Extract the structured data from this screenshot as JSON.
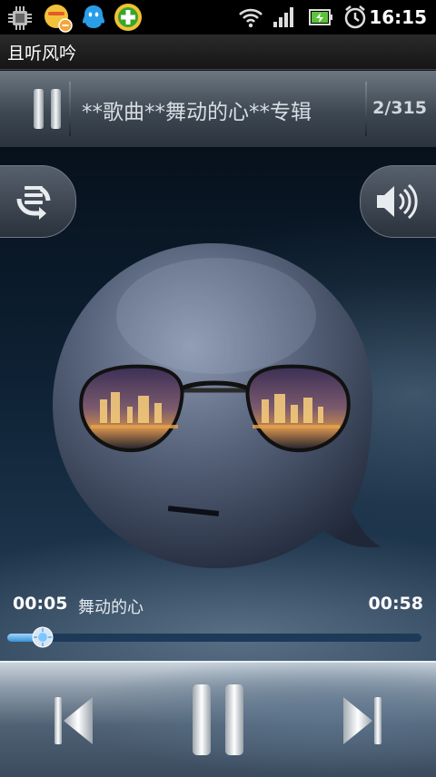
{
  "status_bar": {
    "time": "16:15",
    "icons": [
      "cpu-icon",
      "chat-notification-icon",
      "qq-icon",
      "security-plus-icon",
      "wifi-icon",
      "signal-icon",
      "battery-charging-icon",
      "alarm-clock-icon"
    ]
  },
  "app": {
    "title": "且听风吟"
  },
  "now_playing": {
    "title": "**歌曲**舞动的心**专辑",
    "track_count": "2/315"
  },
  "player": {
    "current_time": "00:05",
    "song_name": "舞动的心",
    "total_time": "00:58",
    "progress": 0.086
  },
  "colors": {
    "accent": "#4aa8ee",
    "title_bar": "#1f1f1f"
  }
}
